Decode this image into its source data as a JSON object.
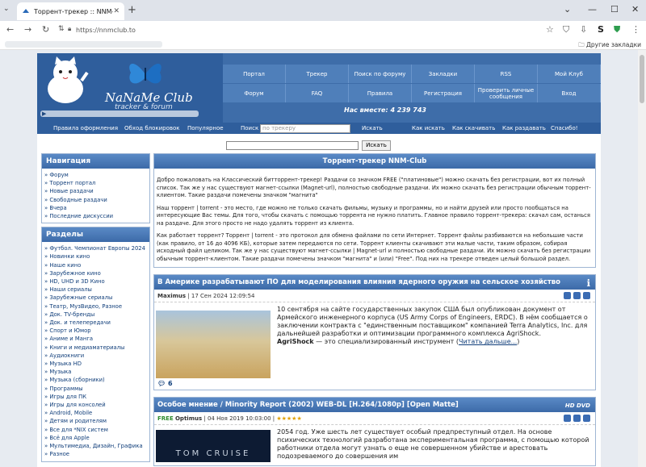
{
  "browser": {
    "tab_title": "Торрент-трекер :: NNM-Club",
    "url": "https://nnmclub.to",
    "other_bookmarks": "Другие закладки"
  },
  "site": {
    "logo_name": "NaNaMe Club",
    "logo_sub": "tracker & forum",
    "nav_row1": [
      "Портал",
      "Трекер",
      "Поиск по форуму",
      "Закладки",
      "RSS",
      "Мой Клуб"
    ],
    "nav_row2": [
      "Форум",
      "FAQ",
      "Правила",
      "Регистрация",
      "Проверить личные сообщения",
      "Вход"
    ],
    "online": "Нас вместе: 4 239 743",
    "menubar": {
      "items_left": [
        "Правила оформления",
        "Обход блокировок",
        "Популярное"
      ],
      "search_label": "Поиск :",
      "search_placeholder": "по трекеру",
      "search_button": "Искать",
      "items_right": [
        "Как искать",
        "Как скачивать",
        "Как раздавать",
        "Спасибо!"
      ]
    },
    "top_search_button": "Искать"
  },
  "navigation": {
    "title": "Навигация",
    "items": [
      "» Форум",
      "» Торрент портал",
      "» Новые раздачи",
      "» Свободные раздачи",
      "» Вчера",
      "» Последние дискуссии"
    ]
  },
  "sections": {
    "title": "Разделы",
    "items": [
      "» Футбол. Чемпионат Европы 2024",
      "» Новинки кино",
      "» Наше кино",
      "» Зарубежное кино",
      "» HD, UHD и 3D Кино",
      "» Наши сериалы",
      "» Зарубежные сериалы",
      "» Театр, МузВидео, Разное",
      "» Док. TV-бренды",
      "» Док. и телепередачи",
      "» Спорт и Юмор",
      "» Аниме и Манга",
      "» Книги и медиаматериалы",
      "» Аудиокниги",
      "» Музыка HD",
      "» Музыка",
      "» Музыка (сборники)",
      "» Программы",
      "» Игры для ПК",
      "» Игры для консолей",
      "» Android, Mobile",
      "» Детям и родителям",
      "» Все для *NIX систем",
      "» Всё для Apple",
      "» Мультимедиа, Дизайн, Графика",
      "» Разное"
    ]
  },
  "intro": {
    "title": "Торрент-трекер NNM-Club",
    "p1": "Добро пожаловать на Классический битторрент-трекер! Раздачи со значком FREE (\"платиновые\") можно скачать без регистрации, вот их полный список. Так же у нас существуют магнет-ссылки (Magnet-url), полностью свободные раздачи. Их можно скачать без регистрации обычным торрент-клиентом. Такие раздачи помечены значком \"магнита\"",
    "p2": "Наш торрент | torrent - это место, где можно не только скачать фильмы, музыку и программы, но и найти друзей или просто пообщаться на интересующие Вас темы. Для того, чтобы скачать с помощью торрента не нужно платить. Главное правило торрент-трекера: скачал сам, останься на раздаче. Для этого просто не надо удалять торрент из клиента.",
    "p3": "Как работает торрент? Торрент | torrent - это протокол для обмена файлами по сети Интернет. Торрент файлы разбиваются на небольшие части (как правило, от 16 до 4096 КБ), которые затем передаются по сети. Торрент клиенты скачивают эти малые части, таким образом, собирая исходный файл целиком. Так же у нас существуют магнет-ссылки | Magnet-url и полностью свободные раздачи. Их можно скачать без регистрации обычным торрент-клиентом. Такие раздачи помечены значком \"магнита\" и (или) \"Free\". Под них на трекере отведен целый большой раздел."
  },
  "news1": {
    "title": "В Америке разрабатывают ПО для моделирования влияния ядерного оружия на сельское хозяйство",
    "author": "Maximus",
    "date": "17 Сен 2024 12:09:54",
    "text": "10 сентября на сайте государственных закупок США был опубликован документ от Армейского инженерного корпуса (US Army Corps of Engineers, ERDC). В нём сообщается о заключении контракта с \"единственным поставщиком\" компанией Terra Analytics, Inc. для дальнейшей разработки и оптимизации программного комплекса AgriShock.",
    "term": "AgriShock",
    "text2": " — это специализированный инструмент (",
    "readmore": "Читать дальше...",
    "comments": "6"
  },
  "news2": {
    "title": "Особое мнение / Minority Report (2002) WEB-DL [H.264/1080p] [Open Matte]",
    "badge": "FREE",
    "author": "Optimus",
    "date": "04 Ноя 2019 10:03:00",
    "stars": "★★★★★",
    "text": "2054 год. Уже шесть лет существует особый предпреступный отдел. На основе психических технологий разработана экспериментальная программа, с помощью которой работники отдела могут узнать о еще не совершенном убийстве и арестовать подозреваемого до совершения им",
    "poster_text": "TOM CRUISE"
  }
}
